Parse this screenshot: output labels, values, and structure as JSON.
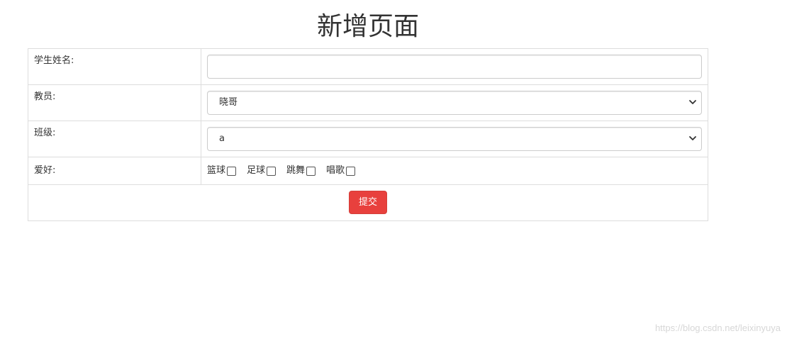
{
  "page": {
    "title": "新增页面"
  },
  "form": {
    "student_name": {
      "label": "学生姓名:",
      "value": "",
      "placeholder": ""
    },
    "teacher": {
      "label": "教员:",
      "selected": "晓哥"
    },
    "class": {
      "label": "班级:",
      "selected": "a"
    },
    "hobbies": {
      "label": "爱好:",
      "options": [
        {
          "label": "篮球",
          "checked": false
        },
        {
          "label": "足球",
          "checked": false
        },
        {
          "label": "跳舞",
          "checked": false
        },
        {
          "label": "唱歌",
          "checked": false
        }
      ]
    },
    "submit_label": "提交"
  },
  "colors": {
    "submit_bg": "#e8403d",
    "border": "#dddddd"
  },
  "watermark": "https://blog.csdn.net/leixinyuya"
}
